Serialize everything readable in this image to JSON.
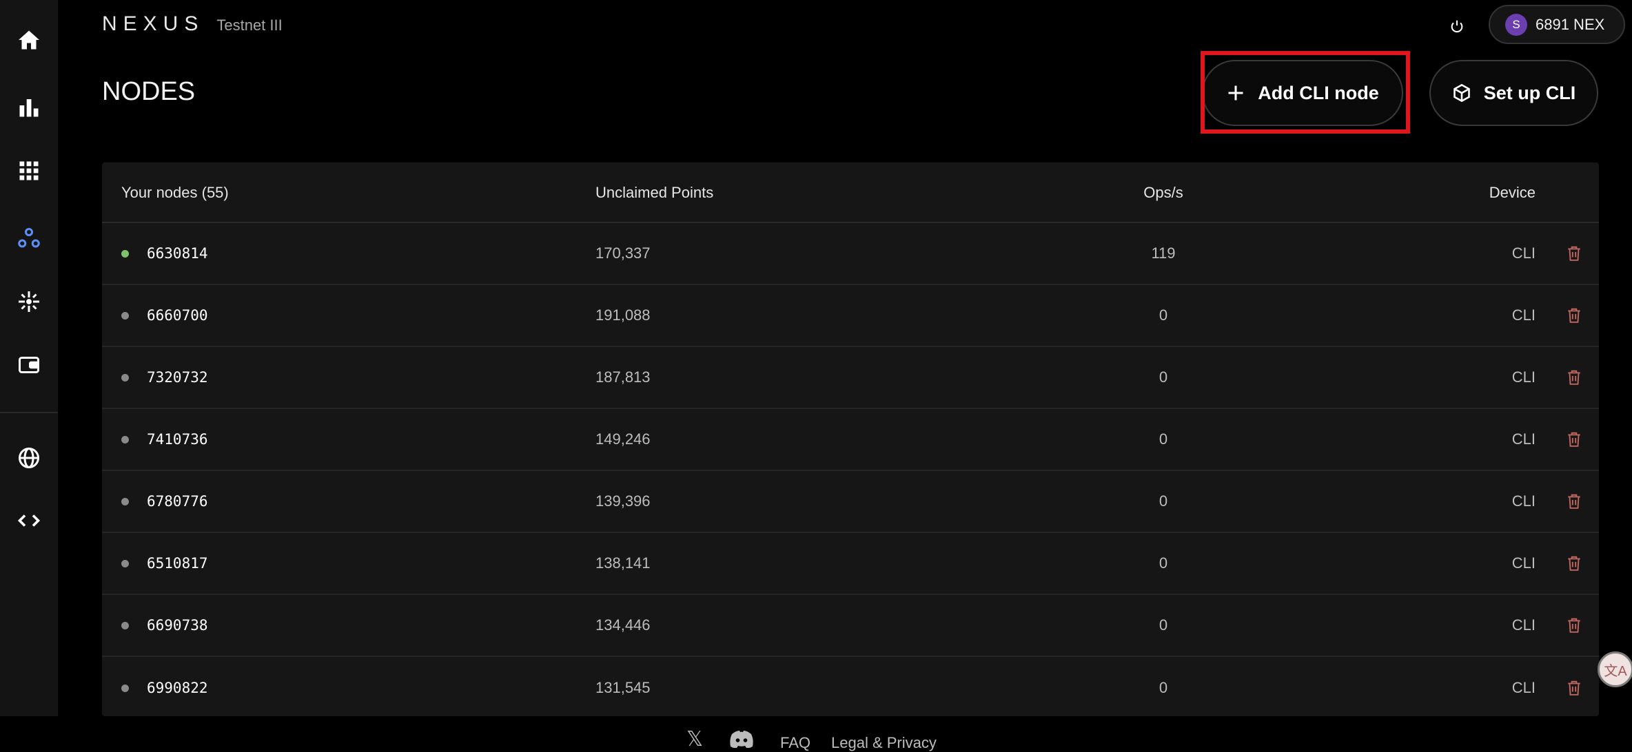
{
  "brand": {
    "name": "NEXUS",
    "network": "Testnet III"
  },
  "header": {
    "wallet_avatar_letter": "S",
    "wallet_balance": "6891 NEX"
  },
  "page": {
    "title": "NODES",
    "add_button_label": "Add CLI node",
    "setup_button_label": "Set up CLI"
  },
  "sidebar": {
    "items": [
      {
        "icon": "home-icon"
      },
      {
        "icon": "bar-chart-icon"
      },
      {
        "icon": "grid-icon"
      },
      {
        "icon": "nodes-icon",
        "active": true
      },
      {
        "icon": "sparkle-icon"
      },
      {
        "icon": "wallet-icon"
      },
      {
        "icon": "globe-icon"
      },
      {
        "icon": "code-icon"
      }
    ]
  },
  "table": {
    "headers": {
      "nodes": "Your nodes (55)",
      "points": "Unclaimed Points",
      "ops": "Ops/s",
      "device": "Device"
    },
    "rows": [
      {
        "id": "6630814",
        "points": "170,337",
        "ops": "119",
        "device": "CLI",
        "status": "online"
      },
      {
        "id": "6660700",
        "points": "191,088",
        "ops": "0",
        "device": "CLI",
        "status": "offline"
      },
      {
        "id": "7320732",
        "points": "187,813",
        "ops": "0",
        "device": "CLI",
        "status": "offline"
      },
      {
        "id": "7410736",
        "points": "149,246",
        "ops": "0",
        "device": "CLI",
        "status": "offline"
      },
      {
        "id": "6780776",
        "points": "139,396",
        "ops": "0",
        "device": "CLI",
        "status": "offline"
      },
      {
        "id": "6510817",
        "points": "138,141",
        "ops": "0",
        "device": "CLI",
        "status": "offline"
      },
      {
        "id": "6690738",
        "points": "134,446",
        "ops": "0",
        "device": "CLI",
        "status": "offline"
      },
      {
        "id": "6990822",
        "points": "131,545",
        "ops": "0",
        "device": "CLI",
        "status": "offline"
      }
    ]
  },
  "footer": {
    "faq": "FAQ",
    "legal": "Legal & Privacy"
  },
  "colors": {
    "online": "#7dc16b",
    "offline": "#8a8a8a",
    "accent": "#5b8ff9",
    "delete": "#c0665f",
    "highlight": "#e0161e"
  }
}
